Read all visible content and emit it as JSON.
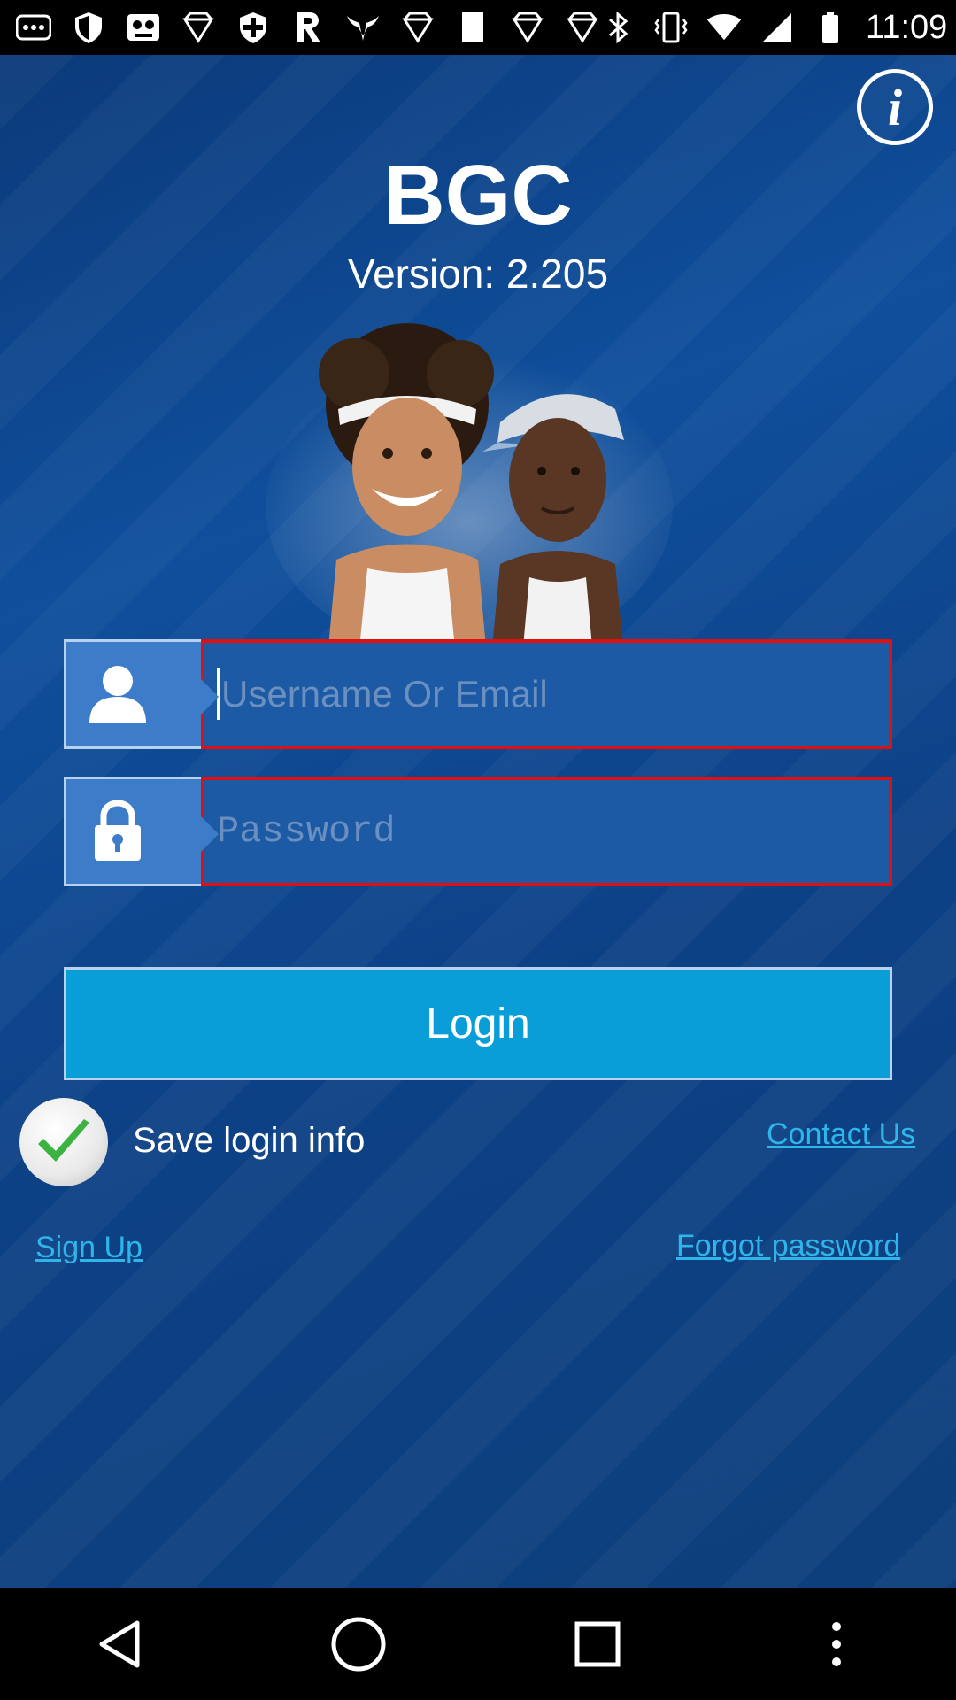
{
  "status_bar": {
    "time": "11:09",
    "left_icons": [
      "more-icon",
      "shield-icon",
      "game-icon",
      "diamond-icon",
      "shield-icon",
      "r-icon",
      "bull-icon",
      "diamond-icon",
      "square-icon",
      "diamond-icon",
      "diamond-icon"
    ],
    "right_icons": [
      "bluetooth-icon",
      "vibrate-icon",
      "wifi-icon",
      "signal-icon",
      "battery-icon"
    ]
  },
  "app": {
    "title": "BGC",
    "version": "Version: 2.205",
    "info_icon": "info-icon",
    "username_placeholder": "Username Or Email",
    "password_placeholder": "Password",
    "login_label": "Login",
    "save_login_label": "Save login info",
    "save_login_checked": true,
    "contact_label": "Contact Us",
    "signup_label": "Sign Up",
    "forgot_label": "Forgot password",
    "colors": {
      "background": "#0d4186",
      "input_border": "#e01010",
      "login_button": "#0a9ed8",
      "link": "#2fb5ea"
    }
  },
  "nav_bar": {
    "buttons": [
      "back-icon",
      "home-icon",
      "recents-icon",
      "menu-icon"
    ]
  }
}
